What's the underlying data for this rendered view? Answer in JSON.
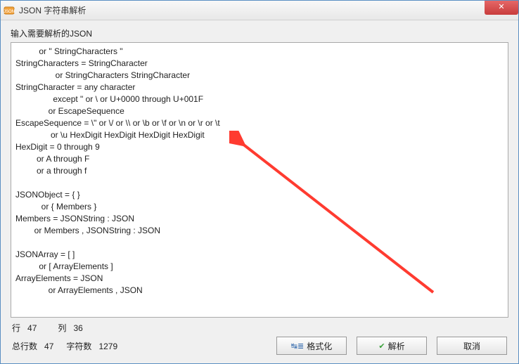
{
  "window": {
    "title": "JSON 字符串解析",
    "close_label": "✕"
  },
  "label": {
    "input_prompt": "输入需要解析的JSON"
  },
  "editor": {
    "content": "          or \" StringCharacters \"\nStringCharacters = StringCharacter\n                 or StringCharacters StringCharacter\nStringCharacter = any character\n                except \" or \\ or U+0000 through U+001F\n              or EscapeSequence\nEscapeSequence = \\\" or \\/ or \\\\ or \\b or \\f or \\n or \\r or \\t\n               or \\u HexDigit HexDigit HexDigit HexDigit\nHexDigit = 0 through 9\n         or A through F\n         or a through f\n\nJSONObject = { }\n           or { Members }\nMembers = JSONString : JSON\n        or Members , JSONString : JSON\n\nJSONArray = [ ]\n          or [ ArrayElements ]\nArrayElements = JSON\n              or ArrayElements , JSON"
  },
  "status": {
    "row_label": "行",
    "row_value": "47",
    "col_label": "列",
    "col_value": "36",
    "total_rows_label": "总行数",
    "total_rows_value": "47",
    "char_count_label": "字符数",
    "char_count_value": "1279"
  },
  "buttons": {
    "format": "格式化",
    "parse": "解析",
    "cancel": "取消"
  }
}
